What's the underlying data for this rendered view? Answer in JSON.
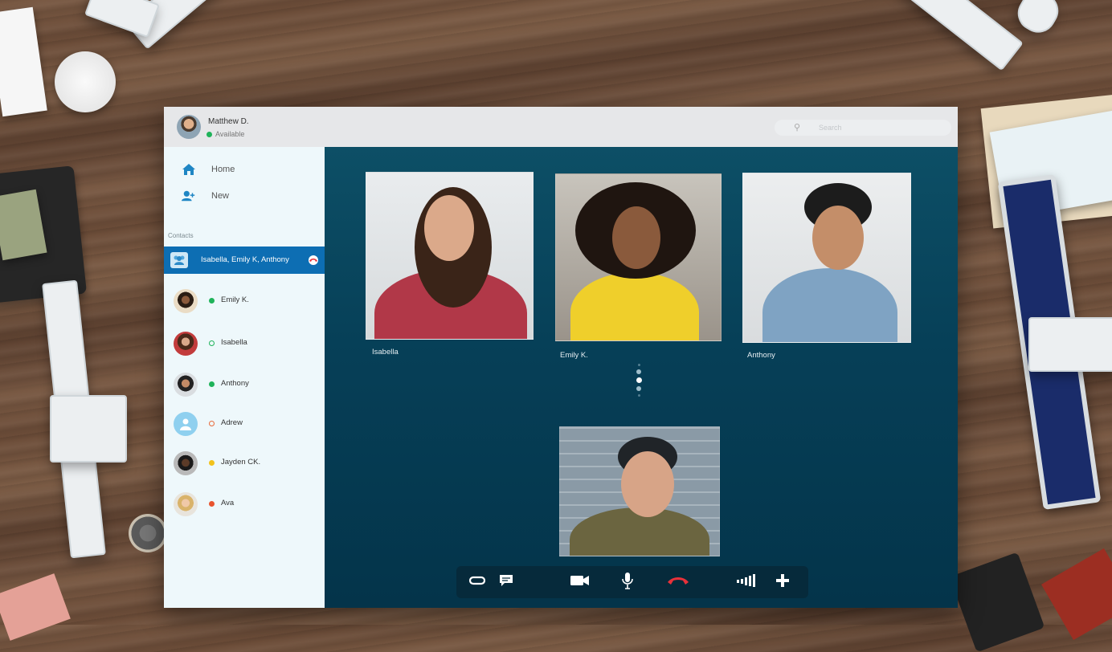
{
  "user": {
    "name": "Matthew D.",
    "status": "Available",
    "status_color": "#1fb35a"
  },
  "search": {
    "placeholder": "Search",
    "icon": "search-icon"
  },
  "nav": [
    {
      "label": "Home",
      "icon": "home-icon"
    },
    {
      "label": "New",
      "icon": "add-user-icon"
    }
  ],
  "contacts_heading": "Contacts",
  "active_call": {
    "label": "Isabella, Emily K, Anthony",
    "icon": "group-call-icon",
    "end_icon": "hang-up-icon"
  },
  "contacts": [
    {
      "name": "Emily K.",
      "status": "online",
      "status_color": "#1fb35a",
      "dot_style": "filled"
    },
    {
      "name": "Isabella",
      "status": "online",
      "status_color": "#1fb35a",
      "dot_style": "hollow"
    },
    {
      "name": "Anthony",
      "status": "online",
      "status_color": "#1fb35a",
      "dot_style": "filled"
    },
    {
      "name": "Adrew",
      "status": "away",
      "status_color": "#e86a3a",
      "dot_style": "hollow"
    },
    {
      "name": "Jayden CK.",
      "status": "busy",
      "status_color": "#f2c21b",
      "dot_style": "filled"
    },
    {
      "name": "Ava",
      "status": "dnd",
      "status_color": "#e8542e",
      "dot_style": "filled"
    }
  ],
  "participants": [
    {
      "name": "Isabella"
    },
    {
      "name": "Emily K."
    },
    {
      "name": "Anthony"
    }
  ],
  "controls": [
    {
      "icon": "link-icon"
    },
    {
      "icon": "chat-icon"
    },
    {
      "icon": "video-camera-icon"
    },
    {
      "icon": "microphone-icon"
    },
    {
      "icon": "end-call-icon",
      "color": "#e8313a"
    },
    {
      "icon": "signal-icon"
    },
    {
      "icon": "add-icon"
    }
  ],
  "colors": {
    "accent": "#0d6eb3",
    "call_bg": "#063f57",
    "sidebar_bg": "#eef8fb"
  }
}
